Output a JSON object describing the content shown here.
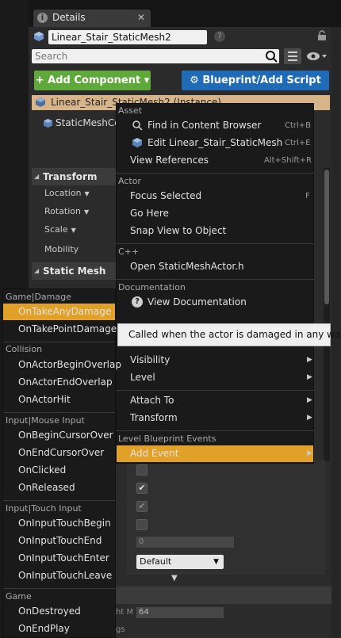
{
  "details_tab": {
    "title": "Details",
    "close": "✕"
  },
  "header": {
    "actor_name": "Linear_Stair_StaticMesh2",
    "help": "?",
    "search_placeholder": "Search"
  },
  "buttons": {
    "add_component": "+ Add Component ▾",
    "blueprint_script": "⚙ Blueprint/Add Script"
  },
  "components": {
    "instance": "Linear_Stair_StaticMesh2 (Instance)",
    "static_mesh_component": "StaticMeshCo"
  },
  "sections": {
    "transform": "Transform",
    "location": "Location",
    "rotation": "Rotation",
    "scale": "Scale",
    "mobility": "Mobility",
    "static_mesh": "Static Mesh"
  },
  "lower": {
    "number_value": "0",
    "dropdown_value": "Default",
    "number_value2": "64",
    "partial_label1": "ht M",
    "partial_label2": "gs"
  },
  "context_menu": {
    "asset_header": "Asset",
    "find_in_browser": "Find in Content Browser",
    "find_shortcut": "Ctrl+B",
    "edit_asset": "Edit Linear_Stair_StaticMesh",
    "edit_shortcut": "Ctrl+E",
    "view_references": "View References",
    "view_ref_shortcut": "Alt+Shift+R",
    "actor_header": "Actor",
    "focus_selected": "Focus Selected",
    "focus_shortcut": "F",
    "go_here": "Go Here",
    "snap_view": "Snap View to Object",
    "cpp_header": "C++",
    "open_header": "Open StaticMeshActor.h",
    "doc_header": "Documentation",
    "view_doc": "View Documentation",
    "visibility": "Visibility",
    "level": "Level",
    "attach_to": "Attach To",
    "transform": "Transform",
    "lb_events_header": "Level Blueprint Events",
    "add_event": "Add Event"
  },
  "tooltip": "Called when the actor is damaged in any way.",
  "submenu": {
    "game_damage": "Game|Damage",
    "on_take_any_damage": "OnTakeAnyDamage",
    "on_take_point_damage": "OnTakePointDamage",
    "collision": "Collision",
    "on_actor_begin_overlap": "OnActorBeginOverlap",
    "on_actor_end_overlap": "OnActorEndOverlap",
    "on_actor_hit": "OnActorHit",
    "input_mouse": "Input|Mouse Input",
    "on_begin_cursor_over": "OnBeginCursorOver",
    "on_end_cursor_over": "OnEndCursorOver",
    "on_clicked": "OnClicked",
    "on_released": "OnReleased",
    "input_touch": "Input|Touch Input",
    "on_input_touch_begin": "OnInputTouchBegin",
    "on_input_touch_end": "OnInputTouchEnd",
    "on_input_touch_enter": "OnInputTouchEnter",
    "on_input_touch_leave": "OnInputTouchLeave",
    "game": "Game",
    "on_destroyed": "OnDestroyed",
    "on_end_play": "OnEndPlay"
  },
  "colors": {
    "highlight": "#e1a128",
    "add_component": "#5fa83a",
    "blueprint": "#1f6bb8",
    "instance_row": "#d8b48a"
  }
}
